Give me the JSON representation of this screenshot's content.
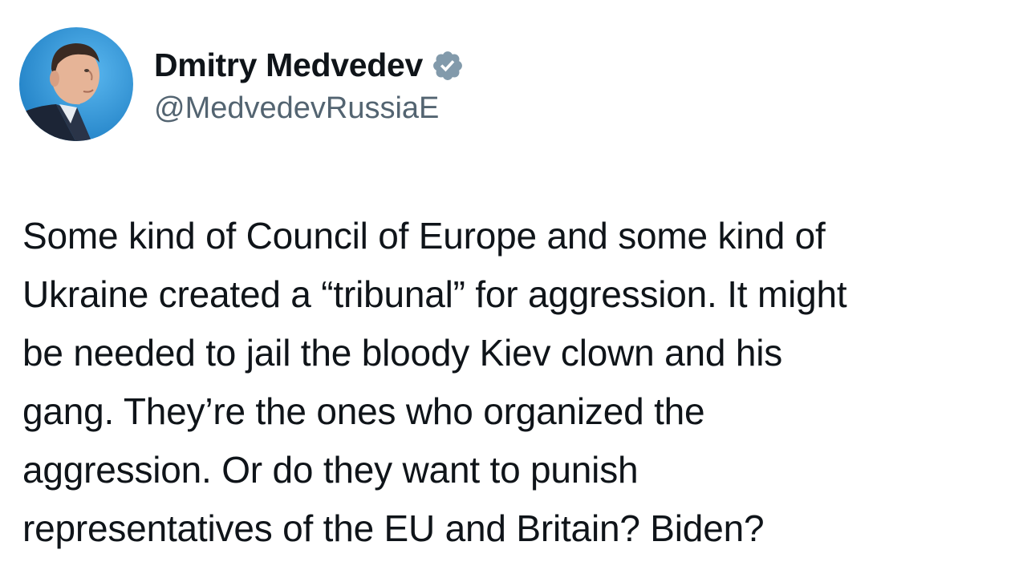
{
  "author": {
    "display_name": "Dmitry Medvedev",
    "handle": "@MedvedevRussiaE",
    "avatar_icon": "profile-photo",
    "verified_icon": "verified-badge-icon",
    "verified_color": "#829aab"
  },
  "tweet": {
    "text_lines": [
      "Some kind of Council of Europe and some kind of",
      "Ukraine created a “tribunal” for aggression. It might",
      "be needed to jail the bloody Kiev clown and his",
      "gang. They’re the ones who organized the",
      "aggression. Or do they want to punish",
      "representatives of the EU and Britain? Biden?"
    ]
  },
  "colors": {
    "text_primary": "#0f1419",
    "text_secondary": "#536471",
    "background": "#ffffff",
    "avatar_bg": "#2f9be0"
  }
}
